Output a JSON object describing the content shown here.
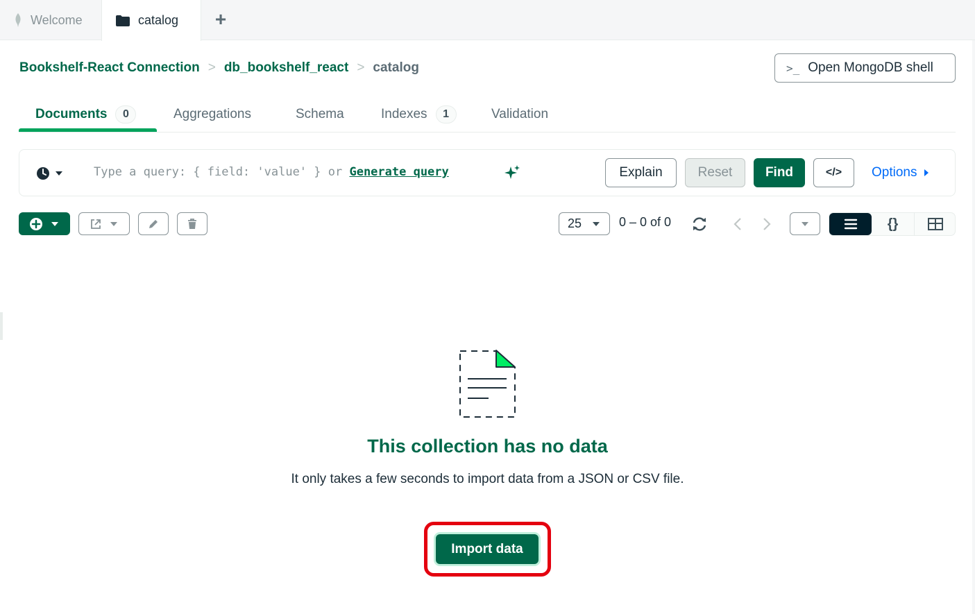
{
  "tabs": {
    "welcome_label": "Welcome",
    "catalog_label": "catalog",
    "add_label": "+"
  },
  "breadcrumb": {
    "connection": "Bookshelf-React Connection",
    "database": "db_bookshelf_react",
    "collection": "catalog",
    "separator": ">"
  },
  "header": {
    "shell_prompt": ">_",
    "shell_label": "Open MongoDB shell"
  },
  "subtabs": {
    "documents": "Documents",
    "documents_count": "0",
    "aggregations": "Aggregations",
    "schema": "Schema",
    "indexes": "Indexes",
    "indexes_count": "1",
    "validation": "Validation"
  },
  "query": {
    "placeholder": "Type a query: { field: 'value' } or ",
    "generate_link": "Generate query",
    "explain": "Explain",
    "reset": "Reset",
    "find": "Find",
    "code": "</>",
    "options": "Options"
  },
  "pagination": {
    "page_size": "25",
    "range": "0 – 0 of 0"
  },
  "view_toggle": {
    "json_glyph": "{}"
  },
  "empty_state": {
    "title": "This collection has no data",
    "description": "It only takes a few seconds to import data from a JSON or CSV file.",
    "button": "Import data"
  },
  "colors": {
    "brand_green": "#00684a",
    "accent_green": "#00a35c",
    "link_blue": "#016bf8",
    "highlight_red": "#e4000f",
    "dark": "#001e2b"
  }
}
